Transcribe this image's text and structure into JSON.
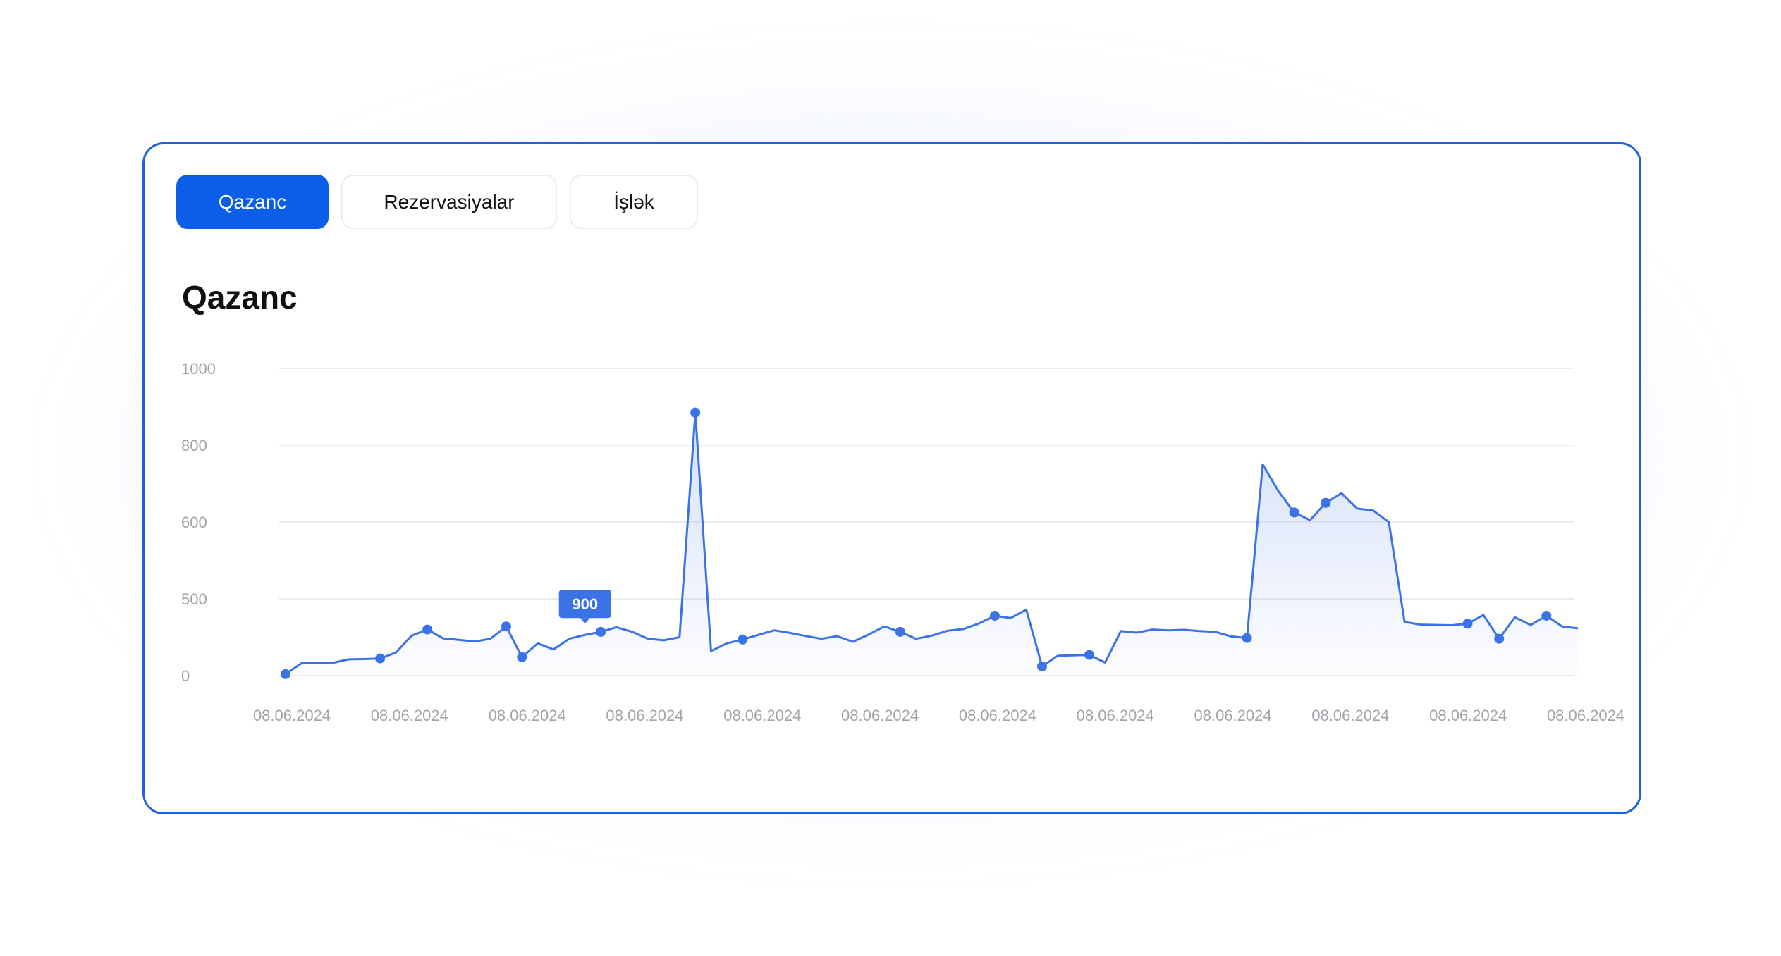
{
  "tabs": [
    {
      "label": "Qazanc",
      "active": true
    },
    {
      "label": "Rezervasiyalar",
      "active": false
    },
    {
      "label": "İşlək",
      "active": false
    }
  ],
  "chart_title": "Qazanc",
  "colors": {
    "accent": "#0b5ee8",
    "line": "#3b73e6",
    "border": "#1f5fe0"
  },
  "chart_data": {
    "type": "area",
    "title": "Qazanc",
    "y_ticks": [
      "1000",
      "800",
      "600",
      "500",
      "0"
    ],
    "x_tick_labels": [
      "08.06.2024",
      "08.06.2024",
      "08.06.2024",
      "08.06.2024",
      "08.06.2024",
      "08.06.2024",
      "08.06.2024",
      "08.06.2024",
      "08.06.2024",
      "08.06.2024",
      "08.06.2024",
      "08.06.2024"
    ],
    "tooltip": {
      "value": "900",
      "point_index": 19
    },
    "grid": true,
    "legend": "none",
    "series": [
      {
        "values": [
          10,
          80,
          82,
          83,
          106,
          108,
          112,
          150,
          260,
          300,
          242,
          233,
          222,
          240,
          320,
          120,
          210,
          170,
          240,
          265,
          285,
          315,
          285,
          240,
          230,
          250,
          885,
          160,
          210,
          235,
          265,
          295,
          278,
          258,
          240,
          257,
          220,
          268,
          320,
          285,
          240,
          260,
          292,
          303,
          340,
          390,
          375,
          430,
          60,
          130,
          132,
          135,
          85,
          290,
          280,
          300,
          295,
          298,
          290,
          285,
          255,
          245,
          750,
          680,
          625,
          605,
          650,
          675,
          635,
          630,
          600,
          350,
          332,
          330,
          328,
          338,
          395,
          240,
          380,
          330,
          390,
          320,
          308
        ],
        "markers": [
          0,
          6,
          9,
          14,
          15,
          20,
          26,
          29,
          39,
          45,
          48,
          51,
          61,
          64,
          66,
          75,
          77,
          80
        ]
      }
    ]
  }
}
